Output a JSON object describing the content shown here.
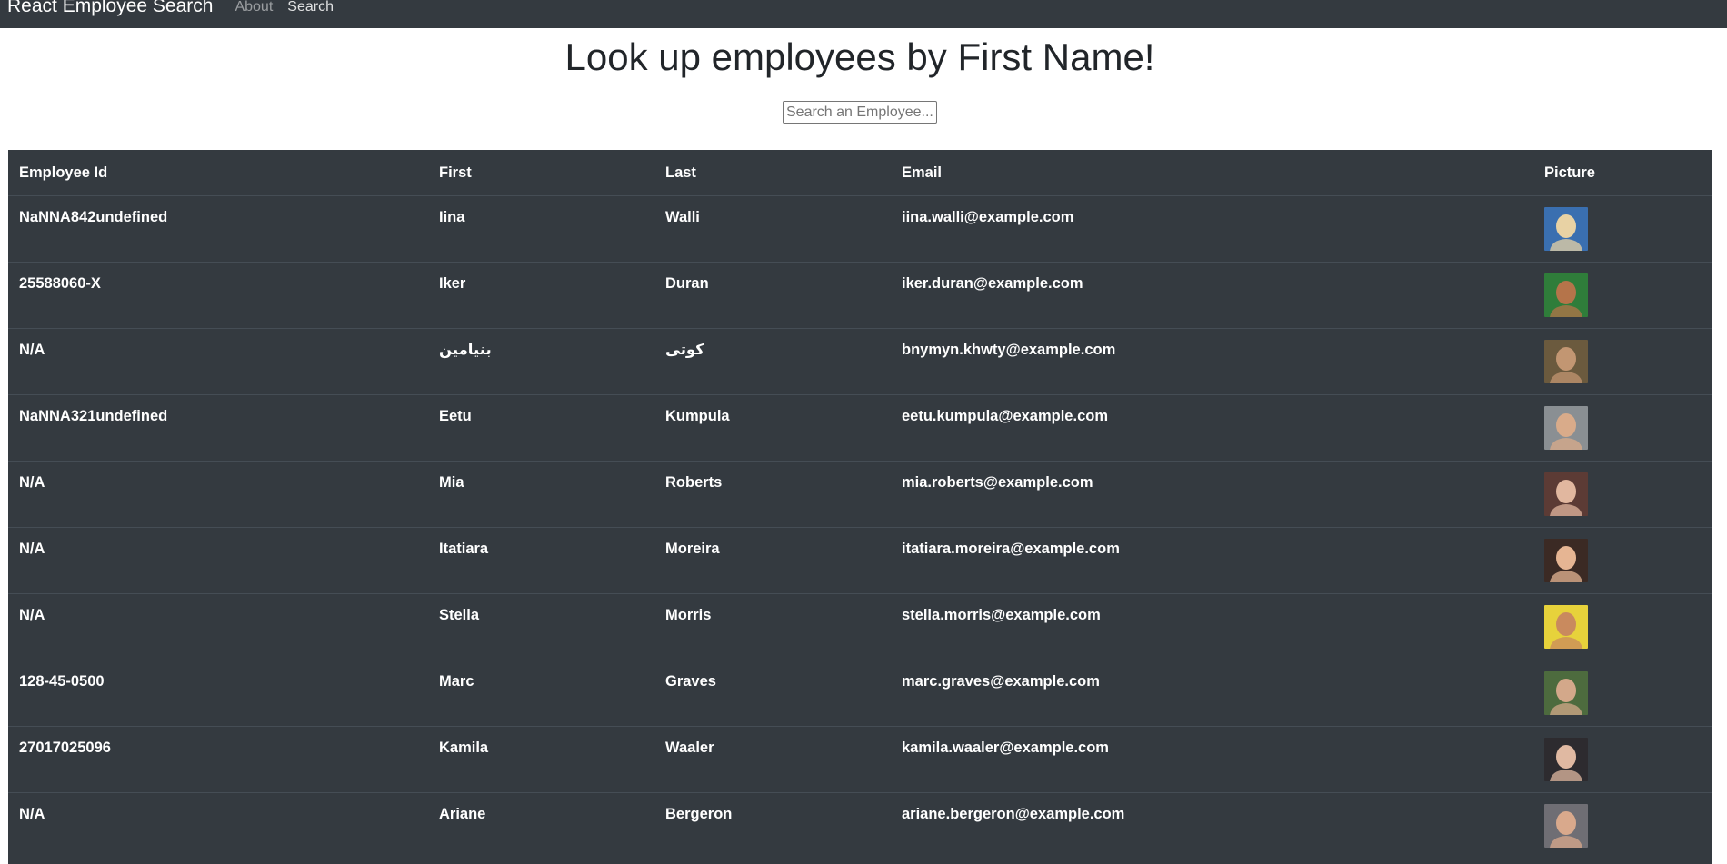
{
  "navbar": {
    "brand": "React Employee Search",
    "links": [
      {
        "label": "About"
      },
      {
        "label": "Search"
      }
    ]
  },
  "page": {
    "title": "Look up employees by First Name!"
  },
  "search": {
    "placeholder": "Search an Employee...",
    "value": ""
  },
  "table": {
    "headers": [
      "Employee Id",
      "First",
      "Last",
      "Email",
      "Picture"
    ],
    "rows": [
      {
        "id": "NaNNA842undefined",
        "first": "Iina",
        "last": "Walli",
        "email": "iina.walli@example.com",
        "avatar_colors": [
          "#3a6fb0",
          "#e8d2a4"
        ]
      },
      {
        "id": "25588060-X",
        "first": "Iker",
        "last": "Duran",
        "email": "iker.duran@example.com",
        "avatar_colors": [
          "#2f7d3a",
          "#b5744a"
        ]
      },
      {
        "id": "N/A",
        "first": "بنیامین",
        "last": "کوتی",
        "email": "bnymyn.khwty@example.com",
        "avatar_colors": [
          "#6b5a3e",
          "#c29672"
        ]
      },
      {
        "id": "NaNNA321undefined",
        "first": "Eetu",
        "last": "Kumpula",
        "email": "eetu.kumpula@example.com",
        "avatar_colors": [
          "#8a8f93",
          "#d9ab8a"
        ]
      },
      {
        "id": "N/A",
        "first": "Mia",
        "last": "Roberts",
        "email": "mia.roberts@example.com",
        "avatar_colors": [
          "#5c3b35",
          "#e1b79f"
        ]
      },
      {
        "id": "N/A",
        "first": "Itatiara",
        "last": "Moreira",
        "email": "itatiara.moreira@example.com",
        "avatar_colors": [
          "#3b2a24",
          "#e6b593"
        ]
      },
      {
        "id": "N/A",
        "first": "Stella",
        "last": "Morris",
        "email": "stella.morris@example.com",
        "avatar_colors": [
          "#e7d23b",
          "#c98a5e"
        ]
      },
      {
        "id": "128-45-0500",
        "first": "Marc",
        "last": "Graves",
        "email": "marc.graves@example.com",
        "avatar_colors": [
          "#4d6b3e",
          "#d3a88a"
        ]
      },
      {
        "id": "27017025096",
        "first": "Kamila",
        "last": "Waaler",
        "email": "kamila.waaler@example.com",
        "avatar_colors": [
          "#2d2b2f",
          "#e0b9a2"
        ]
      },
      {
        "id": "N/A",
        "first": "Ariane",
        "last": "Bergeron",
        "email": "ariane.bergeron@example.com",
        "avatar_colors": [
          "#6f6e74",
          "#d9a98c"
        ]
      }
    ]
  }
}
